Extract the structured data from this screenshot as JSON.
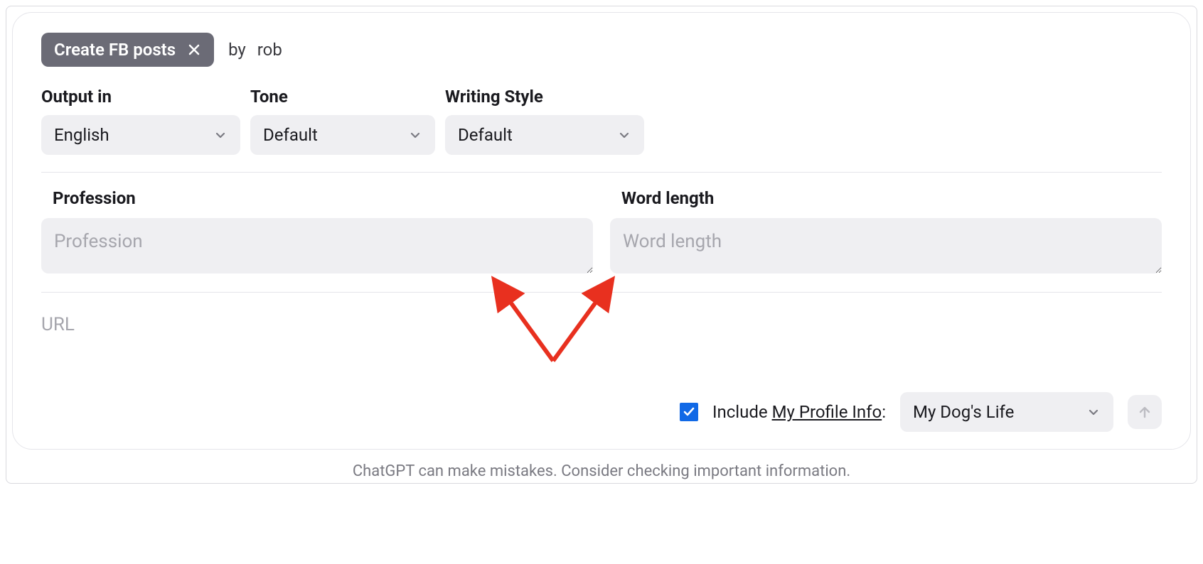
{
  "header": {
    "chip_label": "Create FB posts",
    "by": "by",
    "author": "rob"
  },
  "selectors": {
    "output_in": {
      "label": "Output in",
      "value": "English"
    },
    "tone": {
      "label": "Tone",
      "value": "Default"
    },
    "writing_style": {
      "label": "Writing Style",
      "value": "Default"
    }
  },
  "fields": {
    "profession": {
      "label": "Profession",
      "placeholder": "Profession",
      "value": ""
    },
    "word_length": {
      "label": "Word length",
      "placeholder": "Word length",
      "value": ""
    }
  },
  "url": {
    "placeholder": "URL"
  },
  "footer": {
    "include_text_prefix": "Include ",
    "include_text_link": "My Profile Info",
    "include_text_suffix": ":",
    "profile_value": "My Dog's Life",
    "checked": true
  },
  "disclaimer": "ChatGPT can make mistakes. Consider checking important information."
}
